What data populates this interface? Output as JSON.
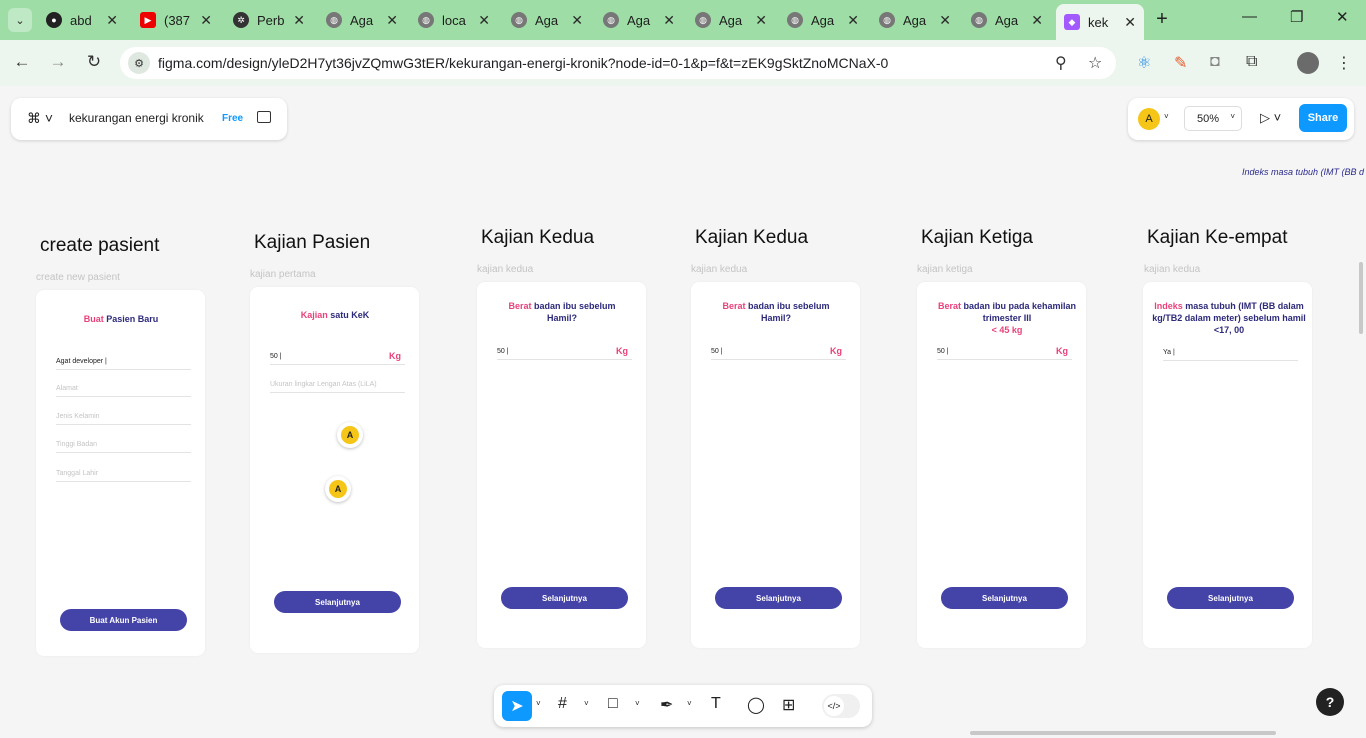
{
  "browser": {
    "tabs": [
      {
        "title": "abd",
        "icon": "github-icon"
      },
      {
        "title": "(387",
        "icon": "youtube-icon"
      },
      {
        "title": "Perb",
        "icon": "chatgpt-icon"
      },
      {
        "title": "Aga",
        "icon": "globe-icon"
      },
      {
        "title": "loca",
        "icon": "globe-icon"
      },
      {
        "title": "Aga",
        "icon": "globe-icon"
      },
      {
        "title": "Aga",
        "icon": "globe-icon"
      },
      {
        "title": "Aga",
        "icon": "globe-icon"
      },
      {
        "title": "Aga",
        "icon": "globe-icon"
      },
      {
        "title": "Aga",
        "icon": "globe-icon"
      },
      {
        "title": "Aga",
        "icon": "globe-icon"
      },
      {
        "title": "kek",
        "icon": "figma-icon"
      }
    ],
    "url": "figma.com/design/yleD2H7yt36jvZQmwG3tER/kekurangan-energi-kronik?node-id=0-1&p=f&t=zEK9gSktZnoMCNaX-0"
  },
  "figma": {
    "file_name": "kekurangan energi kronik",
    "plan_badge": "Free",
    "avatar_letter": "A",
    "zoom": "50%",
    "share_label": "Share",
    "canvas_note": "Indeks masa tubuh (IMT (BB d"
  },
  "frames": [
    {
      "title": "create pasient",
      "label": "create new pasient",
      "heading_pink": "Buat",
      "heading_rest": "Pasien Baru",
      "fields": [
        "Agat developer",
        "Alamat",
        "Jenis Kelamin",
        "Tinggi Badan",
        "Tanggal Lahir"
      ],
      "button": "Buat Akun Pasien"
    },
    {
      "title": "Kajian Pasien",
      "label": "kajian pertama",
      "heading_pink": "Kajian",
      "heading_rest": "satu KeK",
      "field_value": "50",
      "unit": "Kg",
      "field2": "Ukuran lingkar Lengan Atas (LiLA)",
      "button": "Selanjutnya"
    },
    {
      "title": "Kajian Kedua",
      "label": "kajian kedua",
      "heading_pink": "Berat",
      "heading_rest": "badan ibu sebelum Hamil?",
      "field_value": "50",
      "unit": "Kg",
      "button": "Selanjutnya"
    },
    {
      "title": "Kajian Kedua",
      "label": "kajian kedua",
      "heading_pink": "Berat",
      "heading_rest": "badan ibu sebelum Hamil?",
      "field_value": "50",
      "unit": "Kg",
      "button": "Selanjutnya"
    },
    {
      "title": "Kajian Ketiga",
      "label": "kajian ketiga",
      "heading_pink": "Berat",
      "heading_rest": "badan ibu pada kehamilan trimester III",
      "heading_tail": "< 45 kg",
      "field_value": "50",
      "unit": "Kg",
      "button": "Selanjutnya"
    },
    {
      "title": "Kajian Ke-empat",
      "label": "kajian kedua",
      "heading_pink": "Indeks",
      "heading_rest": "masa tubuh (IMT (BB dalam kg/TB2 dalam meter) sebelum hamil <17, 00",
      "field_value": "Ya",
      "button": "Selanjutnya"
    }
  ],
  "cursors": [
    "A",
    "A"
  ]
}
